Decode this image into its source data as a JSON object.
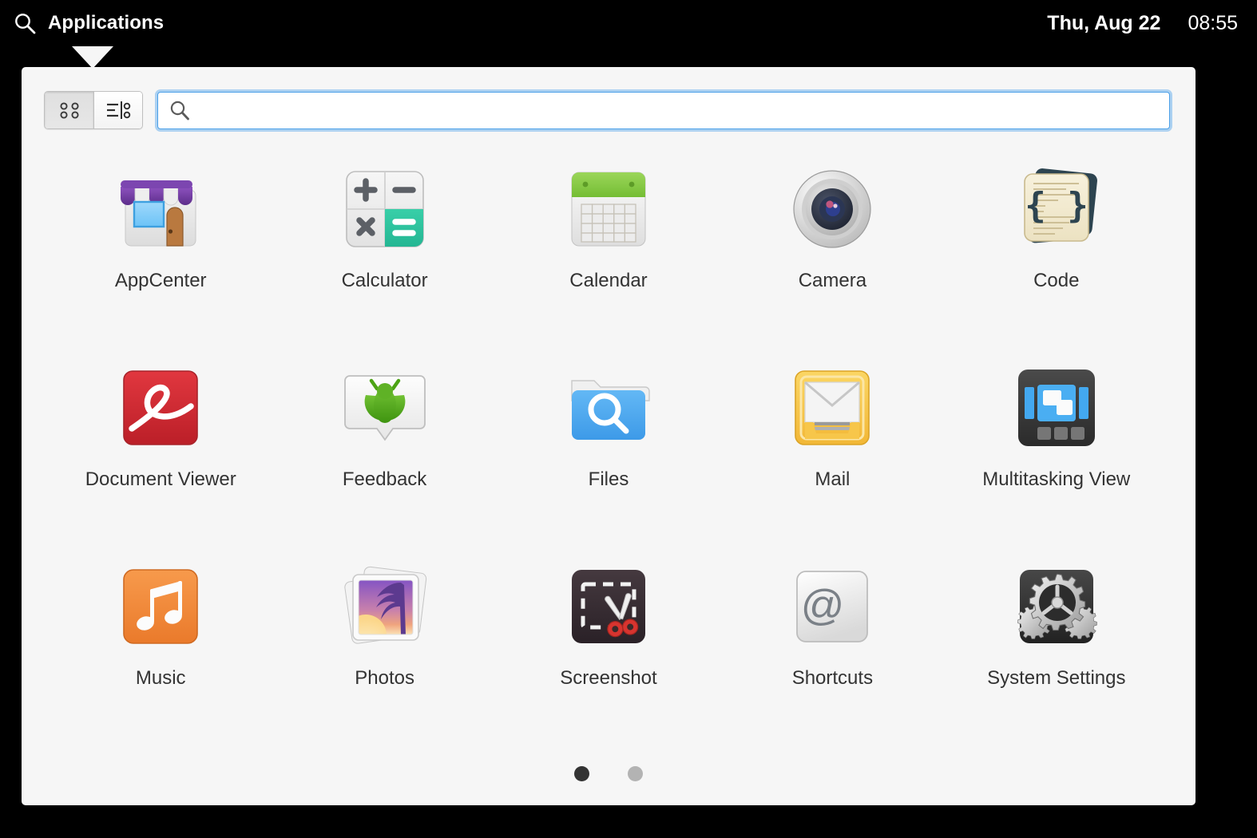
{
  "panel": {
    "search_icon": "search-icon",
    "applications_label": "Applications",
    "date": "Thu, Aug 22",
    "time": "08:55"
  },
  "popover": {
    "view_switcher": {
      "grid_view": {
        "label": "Grid View",
        "icon": "grid-dots-icon",
        "active": true
      },
      "category_view": {
        "label": "Category View",
        "icon": "category-list-icon",
        "active": false
      }
    },
    "search": {
      "icon": "search-icon",
      "value": "",
      "placeholder": "",
      "focused": true,
      "focus_color": "#4a9fe8"
    },
    "apps": [
      {
        "name": "AppCenter",
        "icon": "appcenter-icon"
      },
      {
        "name": "Calculator",
        "icon": "calculator-icon"
      },
      {
        "name": "Calendar",
        "icon": "calendar-icon"
      },
      {
        "name": "Camera",
        "icon": "camera-icon"
      },
      {
        "name": "Code",
        "icon": "code-icon"
      },
      {
        "name": "Document Viewer",
        "icon": "document-viewer-icon"
      },
      {
        "name": "Feedback",
        "icon": "feedback-bug-icon"
      },
      {
        "name": "Files",
        "icon": "files-folder-icon"
      },
      {
        "name": "Mail",
        "icon": "mail-envelope-icon"
      },
      {
        "name": "Multitasking View",
        "icon": "multitasking-view-icon"
      },
      {
        "name": "Music",
        "icon": "music-note-icon"
      },
      {
        "name": "Photos",
        "icon": "photos-icon"
      },
      {
        "name": "Screenshot",
        "icon": "screenshot-scissors-icon"
      },
      {
        "name": "Shortcuts",
        "icon": "shortcuts-at-key-icon"
      },
      {
        "name": "System Settings",
        "icon": "system-settings-gears-icon"
      }
    ],
    "pagination": {
      "pages": 2,
      "current": 1
    }
  },
  "colors": {
    "panel_background": "#000000",
    "popover_background": "#f6f6f6",
    "label_text": "#333333",
    "focus_ring": "#53a5ec",
    "dot_active": "#333333",
    "dot_inactive": "#b3b3b3"
  }
}
